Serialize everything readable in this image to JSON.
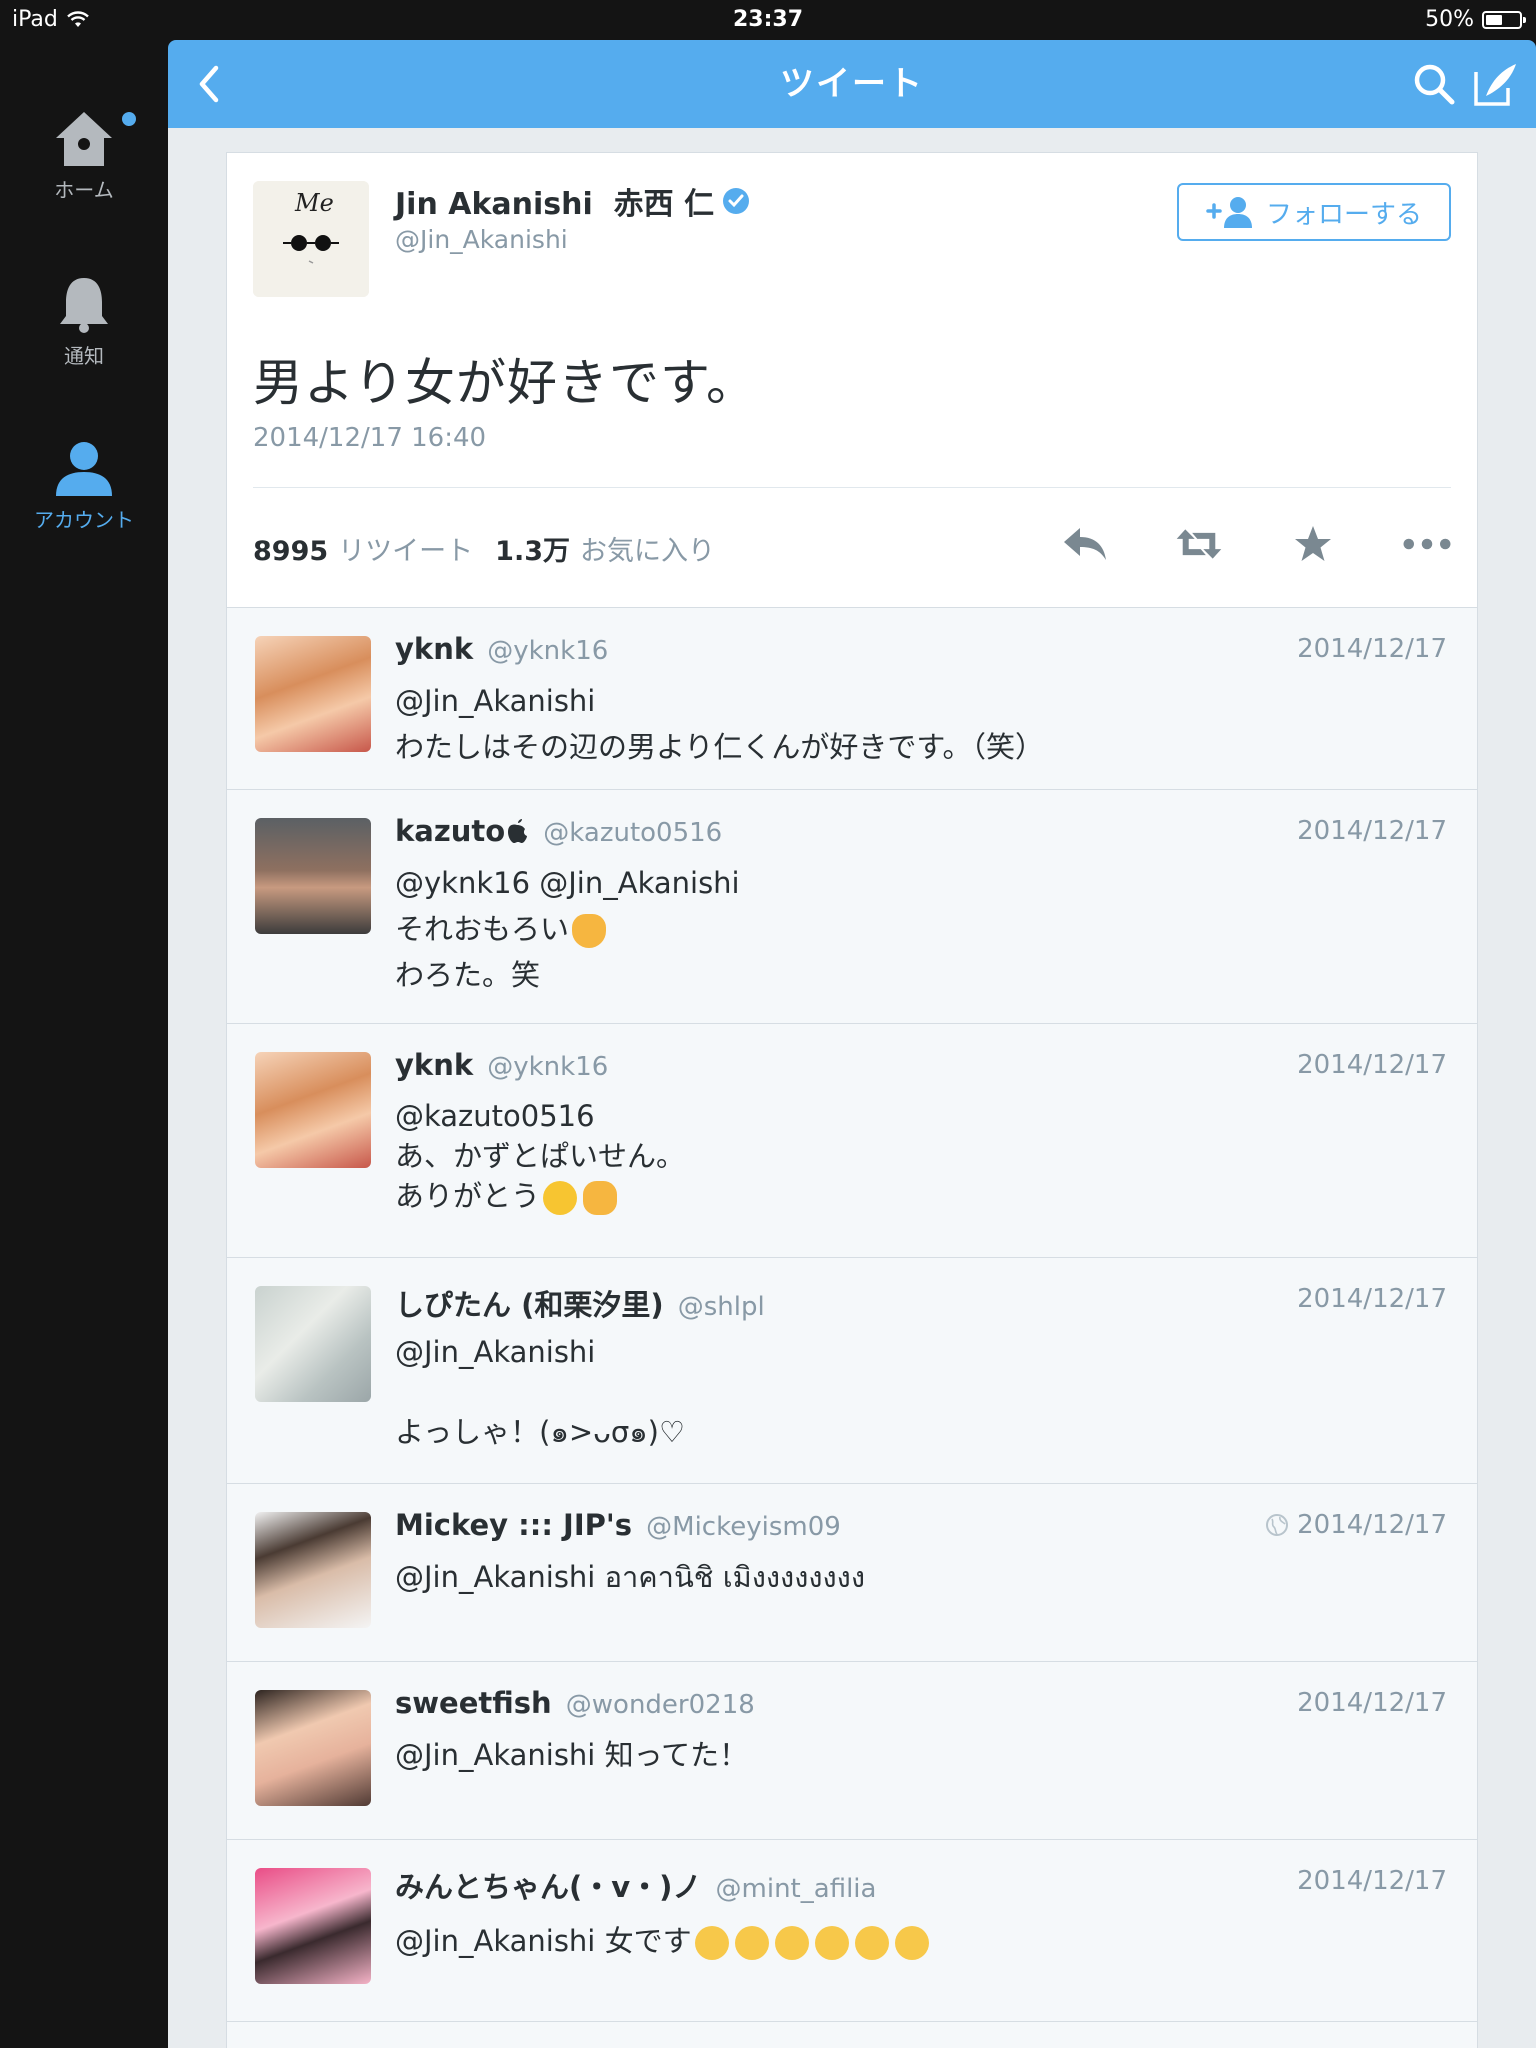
{
  "status_bar": {
    "device": "iPad",
    "time": "23:37",
    "battery": "50%",
    "battery_level": 0.5
  },
  "sidebar": {
    "items": [
      {
        "label": "ホーム"
      },
      {
        "label": "通知"
      },
      {
        "label": "アカウント"
      }
    ]
  },
  "topbar": {
    "title": "ツイート"
  },
  "tweet": {
    "name": "Jin Akanishi  赤西 仁",
    "handle": "@Jin_Akanishi",
    "follow_label": "フォローする",
    "text": "男より女が好きです。",
    "date": "2014/12/17 16:40",
    "retweets": "8995",
    "retweets_label": "リツイート",
    "favorites": "1.3万",
    "favorites_label": "お気に入り",
    "avatar_text": "Me"
  },
  "replies": [
    {
      "name": "yknk",
      "handle": "@yknk16",
      "date": "2014/12/17",
      "line1": "@Jin_Akanishi",
      "line2": "わたしはその辺の男より仁くんが好きです。（笑）",
      "line3": ""
    },
    {
      "name": "kazuto",
      "handle": "@kazuto0516",
      "date": "2014/12/17",
      "line1": "@yknk16 @Jin_Akanishi",
      "line2": "それおもろい",
      "line3": "わろた。笑"
    },
    {
      "name": "yknk",
      "handle": "@yknk16",
      "date": "2014/12/17",
      "line1": "@kazuto0516",
      "line2": "あ、かずとぱいせん。",
      "line3": "ありがとう"
    },
    {
      "name": "しぴたん (和栗汐里)",
      "handle": "@shlpl",
      "date": "2014/12/17",
      "line1": "@Jin_Akanishi",
      "line2": "",
      "line3": "よっしゃ！(๑>ᴗσ๑)♡"
    },
    {
      "name": "Mickey ::: JIP's",
      "handle": "@Mickeyism09",
      "date": "2014/12/17",
      "line1": "@Jin_Akanishi อาคานิชิ เมิงงงงงงงง",
      "line2": "",
      "line3": ""
    },
    {
      "name": "sweetfish",
      "handle": "@wonder0218",
      "date": "2014/12/17",
      "line1": "@Jin_Akanishi 知ってた！",
      "line2": "",
      "line3": ""
    },
    {
      "name": "みんとちゃん(・v・)ノ",
      "handle": "@mint_afilia",
      "date": "2014/12/17",
      "line1": "@Jin_Akanishi 女です",
      "line2": "",
      "line3": ""
    }
  ],
  "colors": {
    "accent": "#55acee",
    "text": "#292f33",
    "muted": "#8899a6",
    "reply_bg": "#f5f8fa"
  }
}
